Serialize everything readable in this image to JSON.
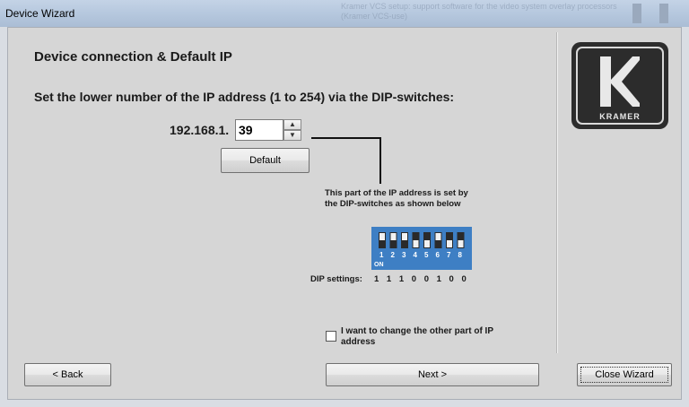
{
  "window": {
    "title": "Device Wizard",
    "background_text": "Kramer VCS setup: support software for the video system overlay processors (Kramer VCS-use)"
  },
  "main": {
    "heading": "Device connection & Default IP",
    "instruction": "Set the lower number of the IP address (1 to 254) via the DIP-switches:",
    "ip_prefix": "192.168.1.",
    "ip_value": "39",
    "default_button": "Default",
    "note_line1": "This part of the IP address is set by",
    "note_line2": "the DIP-switches as shown below",
    "dip_label": "DIP settings:",
    "dip_values": "1 1 1 0 0 1 0 0",
    "dip_switch_numbers": [
      "1",
      "2",
      "3",
      "4",
      "5",
      "6",
      "7",
      "8"
    ],
    "dip_on_label": "ON",
    "dip_states": [
      1,
      1,
      1,
      0,
      0,
      1,
      0,
      0
    ],
    "checkbox_label": "I want to change the other part of IP address",
    "checkbox_checked": false
  },
  "footer": {
    "back": "< Back",
    "next": "Next >",
    "close": "Close Wizard"
  },
  "logo": {
    "text": "KRAMER"
  },
  "colors": {
    "dip_blue": "#3e7fc4",
    "panel": "#d6d6d6",
    "logo_bg": "#2c2c2c"
  }
}
